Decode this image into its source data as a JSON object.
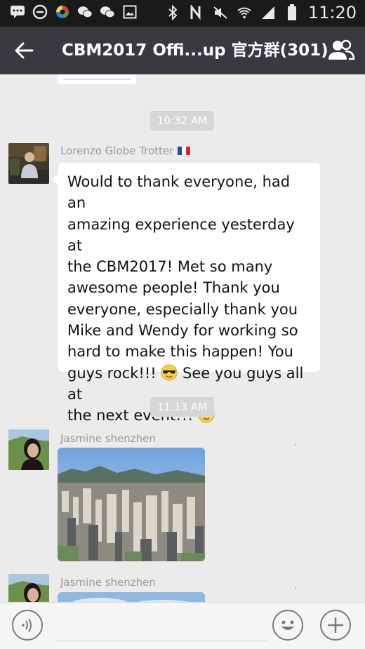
{
  "status_bar": {
    "time": "11:20",
    "left_icons": [
      "message-icon",
      "block-icon",
      "app-color-icon",
      "wechat-icon",
      "wechat-icon-2",
      "image-icon"
    ],
    "right_icons": [
      "bluetooth-icon",
      "nfc-icon",
      "mute-icon",
      "wifi-icon",
      "signal-icon",
      "battery-icon"
    ]
  },
  "header": {
    "back_icon": "back-arrow-icon",
    "title": "CBM2017 Offi...up 官方群(301)",
    "group_icon": "group-members-icon"
  },
  "messages": [
    {
      "type": "timestamp",
      "text": "10:32 AM"
    },
    {
      "type": "text",
      "sender": "Lorenzo Globe Trotter",
      "sender_flag": "france-flag-icon",
      "lines": [
        "Would to thank everyone, had an",
        "amazing experience yesterday at",
        "the CBM2017! Met so many",
        "awesome people! Thank you",
        "everyone, especially thank you",
        "Mike and Wendy for working so",
        "hard to make this happen! You",
        "guys rock!!! ",
        " See you guys all at",
        "the next event!!! "
      ]
    },
    {
      "type": "timestamp",
      "text": "11:13 AM"
    },
    {
      "type": "image",
      "sender": "Jasmine shenzhen",
      "image_desc": "city-skyline-photo"
    },
    {
      "type": "image",
      "sender": "Jasmine shenzhen",
      "image_desc": "sky-photo"
    }
  ],
  "input_bar": {
    "voice_icon": "voice-input-icon",
    "emoji_icon": "emoji-icon",
    "plus_icon": "add-more-icon"
  },
  "colors": {
    "status_bar_bg": "#1a1a1a",
    "header_bg": "#393a3f",
    "chat_bg": "#ebebeb",
    "timestamp_bg": "#d6d6d6"
  }
}
